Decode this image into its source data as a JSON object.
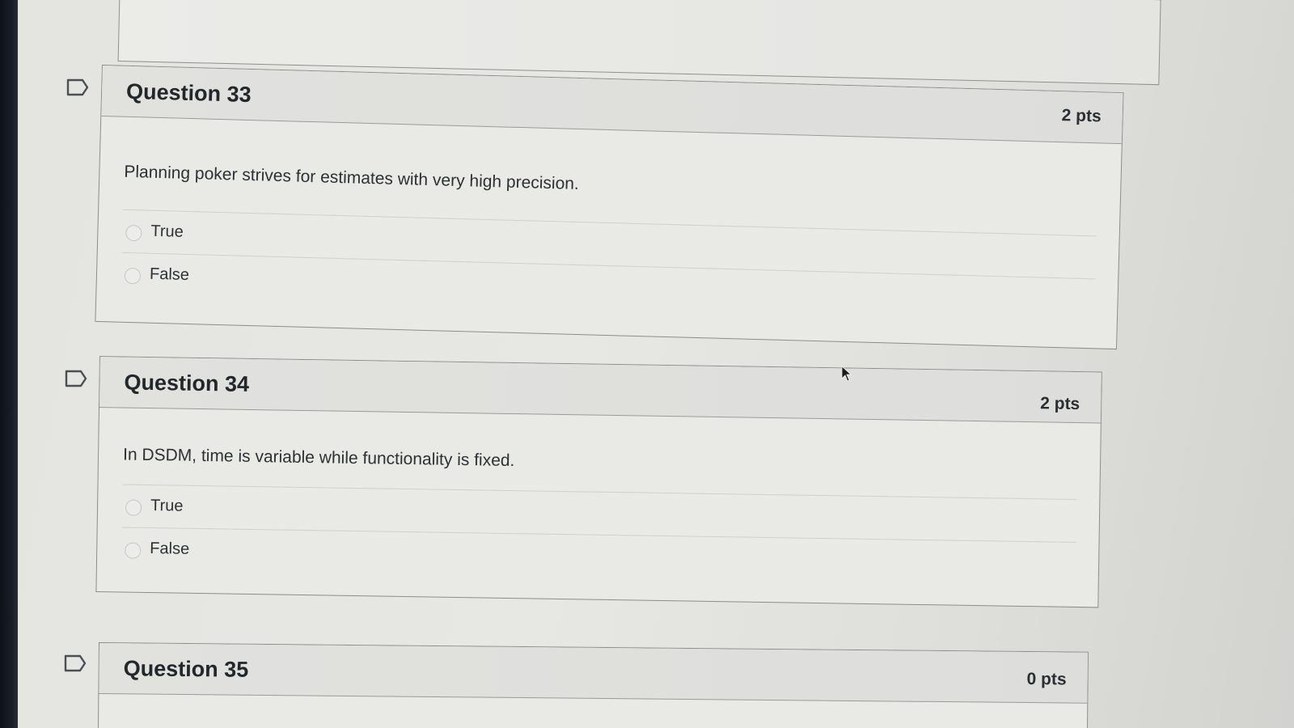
{
  "questions": [
    {
      "title": "Question 33",
      "points": "2 pts",
      "text": "Planning poker strives for estimates with very high precision.",
      "answers": [
        "True",
        "False"
      ]
    },
    {
      "title": "Question 34",
      "points": "2 pts",
      "text": "In DSDM, time is variable while functionality is fixed.",
      "answers": [
        "True",
        "False"
      ]
    },
    {
      "title": "Question 35",
      "points": "0 pts"
    }
  ],
  "icons": {
    "flag": "bookmark-flag-icon",
    "cursor": "mouse-pointer-icon"
  }
}
